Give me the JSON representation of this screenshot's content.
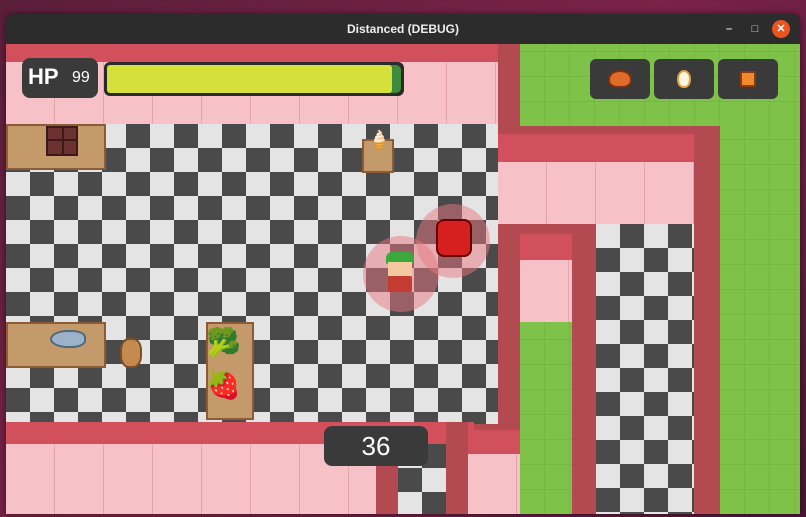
{
  "window": {
    "title": "Distanced (DEBUG)",
    "minimize": "–",
    "maximize": "□",
    "close": "✕"
  },
  "hud": {
    "hp_label": "HP",
    "hp_value": "99",
    "hp_fraction": 0.99,
    "hp_color": "#d6e03b",
    "timer": "36",
    "inventory": [
      {
        "icon": "roast-chicken-icon"
      },
      {
        "icon": "egg-icon"
      },
      {
        "icon": "cheese-icon"
      }
    ]
  },
  "colors": {
    "wall": "#f7c1c8",
    "trim": "#d1505c",
    "floor_dark": "#4a4a4a",
    "floor_light": "#e4e4e4",
    "grass": "#7fc24a"
  }
}
